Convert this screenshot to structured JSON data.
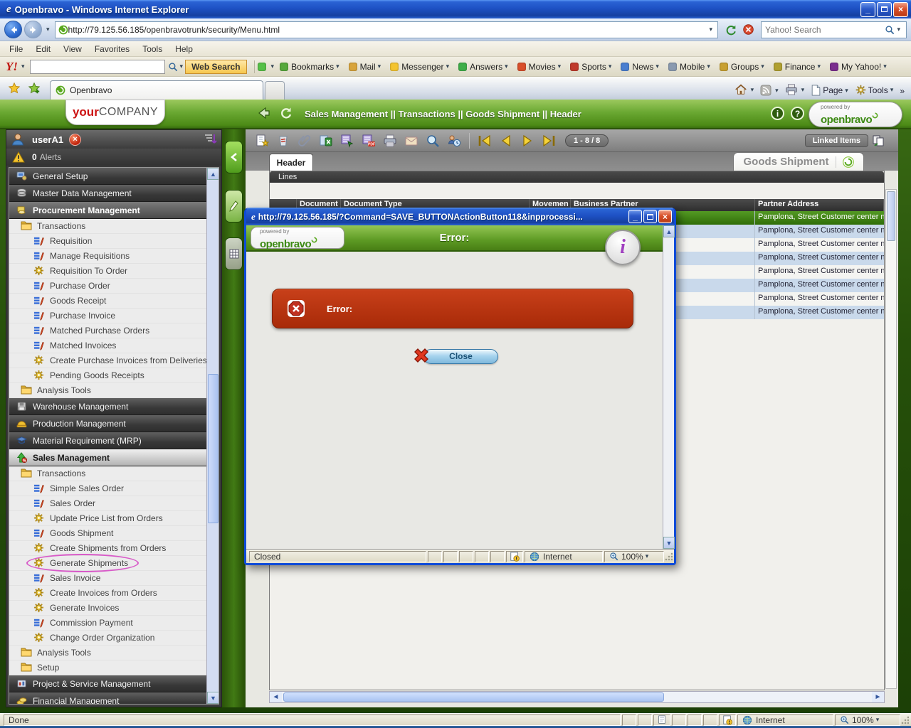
{
  "ie": {
    "title": "Openbravo - Windows Internet Explorer",
    "url": "http://79.125.56.185/openbravotrunk/security/Menu.html",
    "search_placeholder": "Yahoo! Search",
    "menu": [
      "File",
      "Edit",
      "View",
      "Favorites",
      "Tools",
      "Help"
    ],
    "tab_title": "Openbravo",
    "page_label": "Page",
    "tools_label": "Tools",
    "overflow": "»",
    "status": {
      "left": "Done",
      "zone": "Internet",
      "zoom": "100%"
    }
  },
  "yahoo": {
    "logo": "Y!",
    "web_search": "Web Search",
    "items": [
      {
        "label": "Bookmarks",
        "icon": "bookmarks",
        "color": "#57a83c"
      },
      {
        "label": "Mail",
        "icon": "mail",
        "color": "#d8a43c"
      },
      {
        "label": "Messenger",
        "icon": "messenger",
        "color": "#f4c430"
      },
      {
        "label": "Answers",
        "icon": "answers",
        "color": "#3fae49"
      },
      {
        "label": "Movies",
        "icon": "movies",
        "color": "#d94f2b"
      },
      {
        "label": "Sports",
        "icon": "sports",
        "color": "#c03a2b"
      },
      {
        "label": "News",
        "icon": "news",
        "color": "#4a7fd0"
      },
      {
        "label": "Mobile",
        "icon": "mobile",
        "color": "#8a9ab0"
      },
      {
        "label": "Groups",
        "icon": "groups",
        "color": "#c8a030"
      },
      {
        "label": "Finance",
        "icon": "finance",
        "color": "#b0a030"
      },
      {
        "label": "My Yahoo!",
        "icon": "my-yahoo",
        "color": "#7b2d8e"
      }
    ]
  },
  "header": {
    "logo_your": "your",
    "logo_company": "COMPANY",
    "breadcrumb": "Sales Management || Transactions || Goods Shipment  ||  Header",
    "info_glyph": "i",
    "help_glyph": "?",
    "powered_by": "powered by",
    "brand": "openbravo"
  },
  "sidebar": {
    "user": "userA1",
    "alerts_count": "0",
    "alerts_label": "Alerts",
    "items": [
      {
        "label": "General Setup",
        "type": "category",
        "icon": "general-setup"
      },
      {
        "label": "Master Data Management",
        "type": "category",
        "icon": "master-data"
      },
      {
        "label": "Procurement Management",
        "type": "category-open",
        "icon": "procurement"
      },
      {
        "label": "Transactions",
        "type": "folder",
        "icon": "folder"
      },
      {
        "label": "Requisition",
        "type": "form",
        "icon": "form"
      },
      {
        "label": "Manage Requisitions",
        "type": "form",
        "icon": "form"
      },
      {
        "label": "Requisition To Order",
        "type": "process",
        "icon": "process"
      },
      {
        "label": "Purchase Order",
        "type": "form",
        "icon": "form"
      },
      {
        "label": "Goods Receipt",
        "type": "form",
        "icon": "form"
      },
      {
        "label": "Purchase Invoice",
        "type": "form",
        "icon": "form"
      },
      {
        "label": "Matched Purchase Orders",
        "type": "form",
        "icon": "form"
      },
      {
        "label": "Matched Invoices",
        "type": "form",
        "icon": "form"
      },
      {
        "label": "Create Purchase Invoices from Deliveries",
        "type": "process",
        "icon": "process"
      },
      {
        "label": "Pending Goods Receipts",
        "type": "process",
        "icon": "process"
      },
      {
        "label": "Analysis Tools",
        "type": "folder",
        "icon": "folder"
      },
      {
        "label": "Warehouse Management",
        "type": "category",
        "icon": "warehouse"
      },
      {
        "label": "Production Management",
        "type": "category",
        "icon": "production"
      },
      {
        "label": "Material Requirement (MRP)",
        "type": "category",
        "icon": "mrp"
      },
      {
        "label": "Sales Management",
        "type": "category-selected",
        "icon": "sales"
      },
      {
        "label": "Transactions",
        "type": "folder",
        "icon": "folder"
      },
      {
        "label": "Simple Sales Order",
        "type": "form",
        "icon": "form"
      },
      {
        "label": "Sales Order",
        "type": "form",
        "icon": "form"
      },
      {
        "label": "Update Price List from Orders",
        "type": "process",
        "icon": "process"
      },
      {
        "label": "Goods Shipment",
        "type": "form",
        "icon": "form"
      },
      {
        "label": "Create Shipments from Orders",
        "type": "process",
        "icon": "process"
      },
      {
        "label": "Generate Shipments",
        "type": "process",
        "icon": "process",
        "highlighted": true
      },
      {
        "label": "Sales Invoice",
        "type": "form",
        "icon": "form"
      },
      {
        "label": "Create Invoices from Orders",
        "type": "process",
        "icon": "process"
      },
      {
        "label": "Generate Invoices",
        "type": "process",
        "icon": "process"
      },
      {
        "label": "Commission Payment",
        "type": "form",
        "icon": "form"
      },
      {
        "label": "Change Order Organization",
        "type": "process",
        "icon": "process"
      },
      {
        "label": "Analysis Tools",
        "type": "folder",
        "icon": "folder"
      },
      {
        "label": "Setup",
        "type": "folder",
        "icon": "folder"
      },
      {
        "label": "Project & Service Management",
        "type": "category",
        "icon": "project-service"
      },
      {
        "label": "Financial Management",
        "type": "category",
        "icon": "financial"
      }
    ]
  },
  "main": {
    "record_count": "1 - 8 / 8",
    "linked_items": "Linked Items",
    "window_tab": "Goods Shipment",
    "active_tab": "Header",
    "sub_tab": "Lines",
    "toolbar_icons": [
      "new-record",
      "delete",
      "attachment",
      "export-excel",
      "copy-record",
      "export-pdf",
      "print",
      "email",
      "search",
      "audit"
    ],
    "nav_icons": [
      "first-record",
      "previous-record",
      "next-record",
      "last-record"
    ],
    "table": {
      "columns": [
        "Document",
        "Document Type",
        "Movemen",
        "Business Partner",
        "Partner Address"
      ],
      "rows": [
        {
          "partner_address": "Pamplona, Street Customer center n"
        },
        {
          "partner_address": "Pamplona, Street Customer center n"
        },
        {
          "partner_address": "Pamplona, Street Customer center n"
        },
        {
          "partner_address": "Pamplona, Street Customer center n"
        },
        {
          "partner_address": "Pamplona, Street Customer center n"
        },
        {
          "partner_address": "Pamplona, Street Customer center n"
        },
        {
          "partner_address": "Pamplona, Street Customer center n"
        },
        {
          "partner_address": "Pamplona, Street Customer center n"
        }
      ]
    }
  },
  "dialog": {
    "title": "http://79.125.56.185/?Command=SAVE_BUTTONActionButton118&inpprocessi...",
    "powered_by": "powered by",
    "brand": "openbravo",
    "header_title": "Error:",
    "info_glyph": "i",
    "error_label": "Error:",
    "close_label": "Close",
    "status": {
      "left": "Closed",
      "zone": "Internet",
      "zoom": "100%"
    }
  }
}
